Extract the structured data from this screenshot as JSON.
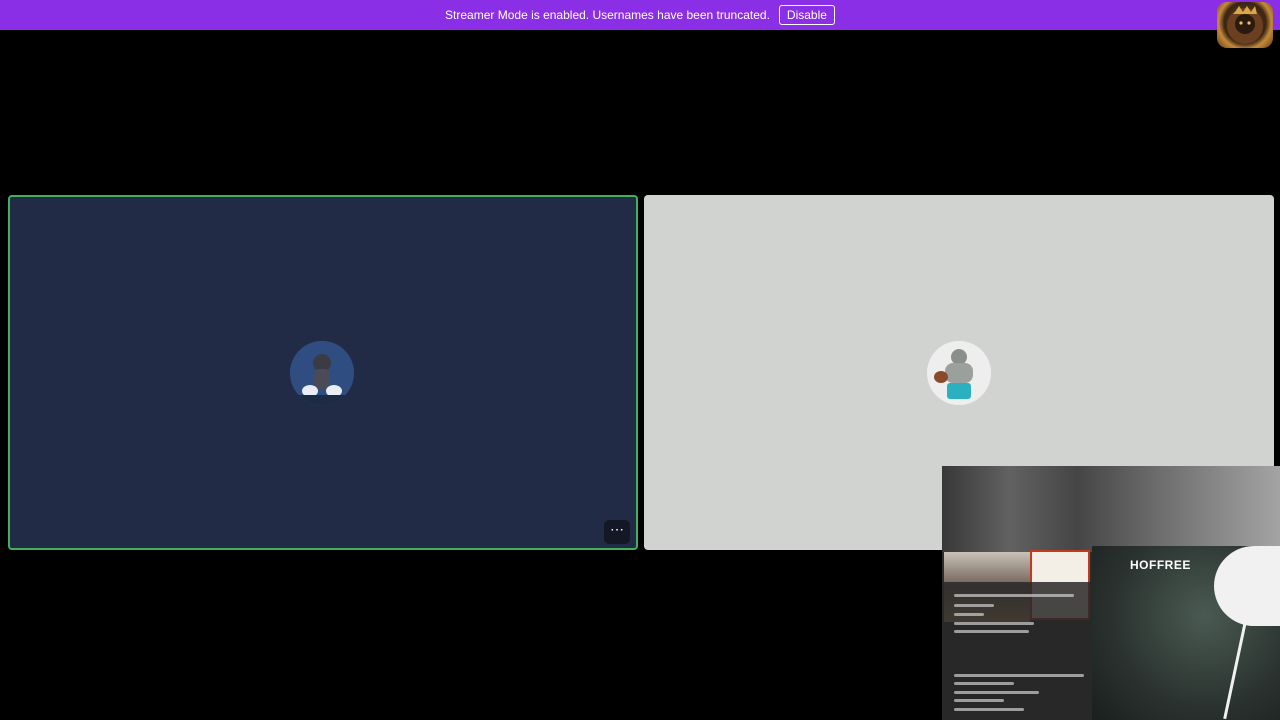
{
  "banner": {
    "message": "Streamer Mode is enabled. Usernames have been truncated.",
    "disable_label": "Disable",
    "background": "#8b2fe6"
  },
  "server_icon": {
    "name": "server-avatar-icon"
  },
  "tiles": [
    {
      "state": "speaking",
      "background": "#222b46",
      "border": "#43b05c",
      "more_label": "⋯"
    },
    {
      "state": "idle",
      "background": "#d1d3d0"
    }
  ],
  "stream_preview": {
    "overlay_text": "HOFFREE"
  }
}
